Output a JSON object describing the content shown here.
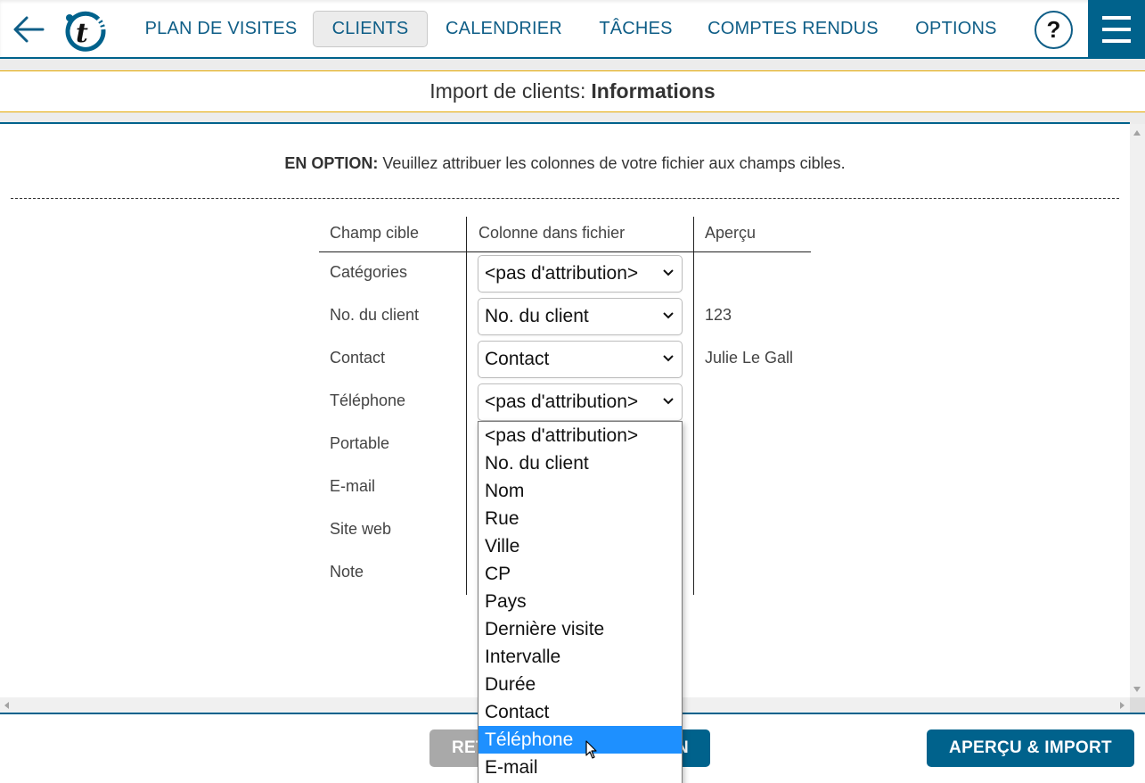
{
  "nav": {
    "back_icon": "arrow-left-icon",
    "logo": "t-logo",
    "items": [
      {
        "label": "PLAN DE VISITES",
        "active": false
      },
      {
        "label": "CLIENTS",
        "active": true
      },
      {
        "label": "CALENDRIER",
        "active": false
      },
      {
        "label": "TÂCHES",
        "active": false
      },
      {
        "label": "COMPTES RENDUS",
        "active": false
      },
      {
        "label": "OPTIONS",
        "active": false
      }
    ],
    "help_label": "?",
    "menu_icon": "hamburger-icon"
  },
  "page": {
    "title_prefix": "Import de clients:",
    "title_bold": "Informations"
  },
  "intro": {
    "bold": "EN OPTION:",
    "text": " Veuillez attribuer les colonnes de votre fichier aux champs cibles."
  },
  "table": {
    "headers": [
      "Champ cible",
      "Colonne dans fichier",
      "Aperçu"
    ],
    "rows": [
      {
        "field": "Catégories",
        "column": "<pas d'attribution>",
        "preview": ""
      },
      {
        "field": "No. du client",
        "column": "No. du client",
        "preview": "123"
      },
      {
        "field": "Contact",
        "column": "Contact",
        "preview": "Julie Le Gall"
      },
      {
        "field": "Téléphone",
        "column": "<pas d'attribution>",
        "preview": ""
      },
      {
        "field": "Portable",
        "column": "",
        "preview": ""
      },
      {
        "field": "E-mail",
        "column": "",
        "preview": ""
      },
      {
        "field": "Site web",
        "column": "",
        "preview": ""
      },
      {
        "field": "Note",
        "column": "",
        "preview": ""
      }
    ]
  },
  "dropdown": {
    "open_for": "Téléphone",
    "highlighted": "Téléphone",
    "options": [
      "<pas d'attribution>",
      "No. du client",
      "Nom",
      "Rue",
      "Ville",
      "CP",
      "Pays",
      "Dernière visite",
      "Intervalle",
      "Durée",
      "Contact",
      "Téléphone",
      "E-mail"
    ]
  },
  "footer": {
    "back_label": "RETOUR",
    "middle_label_visible": "N",
    "import_label": "APERÇU & IMPORT"
  },
  "colors": {
    "brand": "#00628c",
    "accent_line": "#e5a800",
    "highlight": "#1e90ff",
    "disabled_button": "#a9a9a9"
  }
}
